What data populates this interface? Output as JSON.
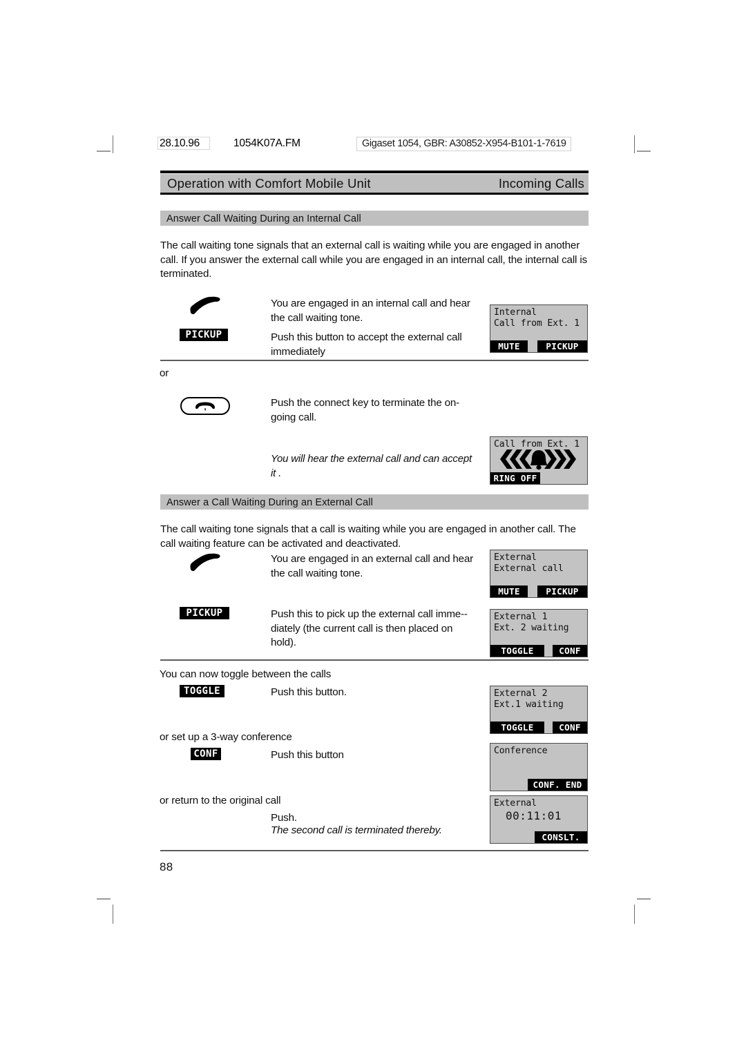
{
  "running_head": {
    "date": "28.10.96",
    "filename": "1054K07A.FM",
    "identifier": "Gigaset 1054, GBR: A30852-X954-B101-1-7619"
  },
  "header": {
    "left": "Operation with Comfort Mobile Unit",
    "right": "Incoming Calls"
  },
  "sections": [
    {
      "heading": "Answer Call Waiting During an Internal Call",
      "paragraph": "The call waiting tone signals that an external call is waiting while you are engaged in another call. If you answer the external call while you are engaged in an internal call, the internal call is terminated."
    },
    {
      "heading": "Answer a Call Waiting During an External Call",
      "paragraph": "The call waiting tone signals that a call is waiting while you are engaged in another call. The call waiting feature can be activated and deactivated."
    }
  ],
  "steps": {
    "s1_desc": "You are engaged in an internal call and hear the call waiting tone.",
    "s2_key": "PICKUP",
    "s2_desc": "Push this button to accept the external call immediately",
    "or_1": "or",
    "s3_desc": "Push the connect key to terminate the on-going call.",
    "s4_desc": "You will hear the external call and can accept it .",
    "s5_desc": "You are engaged in an external call and hear the call waiting tone.",
    "s6_key": "PICKUP",
    "s6_desc": "Push this to pick up the external call imme--diately (the current call is then placed on hold).",
    "toggle_intro": "You can now toggle between the calls",
    "s7_key": "TOGGLE",
    "s7_desc": "Push this button.",
    "conf_intro": "or set up a 3-way conference",
    "s8_key": "CONF",
    "s8_desc": "Push this button",
    "return_intro": "or return to the original call",
    "s9_desc": "Push.",
    "s9_desc_italic": "The second call is terminated thereby."
  },
  "displays": [
    {
      "name": "internal-call-waiting",
      "line1": "Internal",
      "line2": "Call from Ext. 1",
      "softkey_left": "MUTE",
      "softkey_right": "PICKUP"
    },
    {
      "name": "ringing",
      "line1": "Call from Ext. 1",
      "softkey_left": "RING OFF"
    },
    {
      "name": "external-call-waiting",
      "line1": "External",
      "line2": "External call",
      "softkey_left": "MUTE",
      "softkey_right": "PICKUP"
    },
    {
      "name": "external-1-ext-2-waiting",
      "line1": "External 1",
      "line2": "Ext. 2 waiting",
      "softkey_left": "TOGGLE",
      "softkey_right": "CONF"
    },
    {
      "name": "external-2-ext-1-waiting",
      "line1": "External 2",
      "line2": "Ext.1 waiting",
      "softkey_left": "TOGGLE",
      "softkey_right": "CONF"
    },
    {
      "name": "conference",
      "line1": "Conference",
      "softkey_right": "CONF. END"
    },
    {
      "name": "external-timer",
      "line1": "External",
      "timer": "00:11:01",
      "softkey_right": "CONSLT."
    }
  ],
  "page_number": "88"
}
